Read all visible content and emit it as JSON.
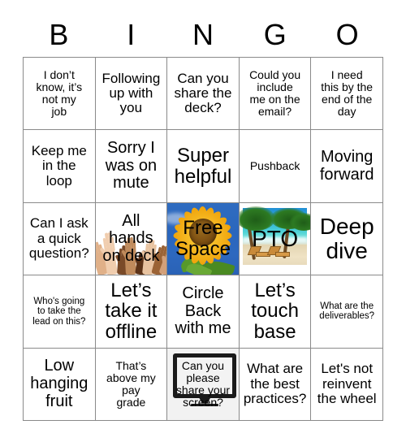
{
  "card": {
    "header_letters": [
      "B",
      "I",
      "N",
      "G",
      "O"
    ],
    "rows": [
      [
        {
          "text": "I don’t\nknow, it’s\nnot my\njob",
          "size": "t-sm",
          "art": "none"
        },
        {
          "text": "Following\nup with\nyou",
          "size": "t-md",
          "art": "none"
        },
        {
          "text": "Can you\nshare the\ndeck?",
          "size": "t-md",
          "art": "none"
        },
        {
          "text": "Could you\ninclude\nme on the\nemail?",
          "size": "t-sm",
          "art": "none"
        },
        {
          "text": "I need\nthis by the\nend of the\nday",
          "size": "t-sm",
          "art": "none"
        }
      ],
      [
        {
          "text": "Keep me\nin the\nloop",
          "size": "t-md",
          "art": "none"
        },
        {
          "text": "Sorry I\nwas on\nmute",
          "size": "t-lg",
          "art": "none"
        },
        {
          "text": "Super\nhelpful",
          "size": "t-xl",
          "art": "none"
        },
        {
          "text": "Pushback",
          "size": "t-sm",
          "art": "none"
        },
        {
          "text": "Moving\nforward",
          "size": "t-lg",
          "art": "none"
        }
      ],
      [
        {
          "text": "Can I ask\na quick\nquestion?",
          "size": "t-md",
          "art": "none"
        },
        {
          "text": "All\nhands\non deck",
          "size": "t-lg",
          "art": "hands"
        },
        {
          "text": "Free\nSpace",
          "size": "t-xl",
          "art": "sunflower"
        },
        {
          "text": "PTO",
          "size": "t-xxl",
          "art": "beach"
        },
        {
          "text": "Deep\ndive",
          "size": "t-xxl",
          "art": "none"
        }
      ],
      [
        {
          "text": "Who's going\nto take the\nlead on this?",
          "size": "t-xs",
          "art": "none"
        },
        {
          "text": "Let’s\ntake it\noffline",
          "size": "t-xl",
          "art": "none"
        },
        {
          "text": "Circle\nBack\nwith me",
          "size": "t-lg",
          "art": "none"
        },
        {
          "text": "Let’s\ntouch\nbase",
          "size": "t-xl",
          "art": "none"
        },
        {
          "text": "What are the\ndeliverables?",
          "size": "t-xs",
          "art": "none"
        }
      ],
      [
        {
          "text": "Low\nhanging\nfruit",
          "size": "t-lg",
          "art": "none"
        },
        {
          "text": "That’s\nabove my\npay\ngrade",
          "size": "t-sm",
          "art": "none"
        },
        {
          "text": "Can you\nplease\nshare your\nscreen?",
          "size": "t-sm",
          "art": "monitor"
        },
        {
          "text": "What are\nthe best\npractices?",
          "size": "t-md",
          "art": "none"
        },
        {
          "text": "Let's not\nreinvent\nthe wheel",
          "size": "t-md",
          "art": "none"
        }
      ]
    ]
  },
  "colors": {
    "grid_line": "#8a8a8a",
    "text": "#000000",
    "background": "#ffffff",
    "sunflower_sky": "#2d68bf",
    "sunflower_petal": "#f0a30a",
    "beach_water": "#3fc4d8",
    "beach_sand": "#e8dbbc",
    "monitor_bezel": "#1a1a1a"
  }
}
